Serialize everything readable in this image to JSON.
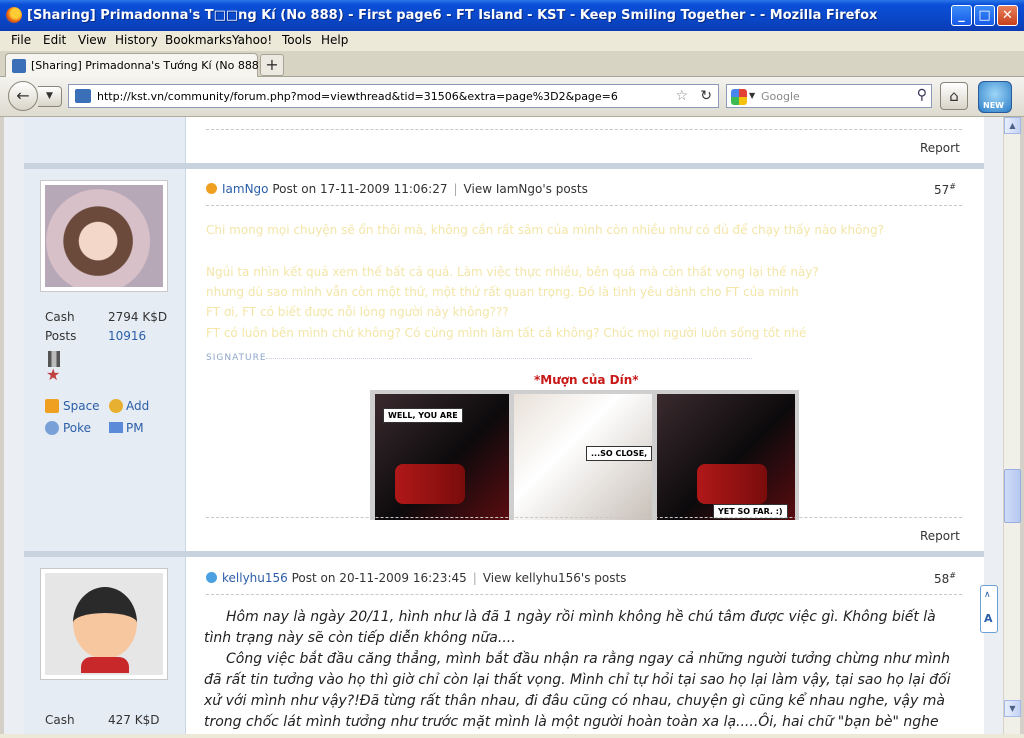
{
  "window": {
    "title": "[Sharing] Primadonna's T□□ng Kí (No 888) - First page6 - FT Island - KST - Keep Smiling Together - - Mozilla Firefox",
    "min": "_",
    "max": "□",
    "close": "✕"
  },
  "menu": [
    "File",
    "Edit",
    "View",
    "History",
    "Bookmarks",
    "Yahoo!",
    "Tools",
    "Help"
  ],
  "tab": {
    "label": "[Sharing] Primadonna's Tướng Kí (No 888) - ...",
    "new_tab": "+"
  },
  "nav": {
    "url": "http://kst.vn/community/forum.php?mod=viewthread&tid=31506&extra=page%3D2&page=6",
    "search_placeholder": "Google",
    "ext_label": "NEW"
  },
  "prev_post": {
    "report": "Report"
  },
  "post57": {
    "user": "IamNgo",
    "posted": "Post on 17-11-2009 11:06:27",
    "view_posts": "View IamNgo's posts",
    "number": "57",
    "cash_label": "Cash",
    "cash_value": "2794 K$D",
    "posts_label": "Posts",
    "posts_value": "10916",
    "links": {
      "space": "Space",
      "add": "Add",
      "poke": "Poke",
      "pm": "PM"
    },
    "faint_lines": [
      "Chi mong mọi chuyện sẽ ổn thôi mà, không cần rất sâm của mình còn nhiều như có đủ để chạy thấy nào không?",
      "Ngủi ta nhìn kết quả xem thế bất cả quá. Làm việc thực nhiều, bên quá mà còn thất vọng lại thế này?",
      "nhưng dù sao mình vẫn còn một thứ, một thứ rất quan trọng. Đó là tình yêu dành cho FT của mình",
      "FT ơi, FT có biết được nỗi lòng người này không???",
      "FT có luôn bên mình chứ không? Có cùng mình làm tất cả không? Chúc mọi người luôn sống tốt nhé"
    ],
    "signature": "SIGNATURE",
    "sig_caption": "*Mượn của Dín*",
    "comic": [
      "WELL, YOU ARE",
      "...SO CLOSE,",
      "YET SO FAR. :)"
    ],
    "report": "Report"
  },
  "post58": {
    "user": "kellyhu156",
    "posted": "Post on 20-11-2009 16:23:45",
    "view_posts": "View kellyhu156's posts",
    "number": "58",
    "cash_label": "Cash",
    "cash_value": "427 K$D",
    "paragraphs": [
      "Hôm nay là ngày 20/11, hình như là đã 1 ngày rồi mình không hề chú tâm được việc gì. Không biết là tình trạng này sẽ còn tiếp diễn không nữa....",
      "Công việc bắt đầu căng thẳng, mình bắt đầu nhận ra rằng ngay cả những người tưởng chừng như mình đã rất tin tưởng vào họ thì giờ chỉ còn lại thất vọng. Mình chỉ tự hỏi tại sao họ lại làm vậy, tại sao họ lại đối xử với mình như vậy?!Đã từng rất thân nhau, đi đâu cũng có nhau, chuyện gì cũng kể nhau nghe, vậy mà trong chốc lát mình tưởng như trước mặt mình là một người hoàn toàn xa lạ.....Ôi, hai chữ \"bạn bè\" nghe sao khó quá......"
    ]
  },
  "float_button": {
    "top": "∧",
    "label": "A"
  },
  "colors": {
    "link": "#2b5ea8",
    "sidebar": "#e5ecf4",
    "title_bar": "#0a47c8",
    "sig_red": "#c81818"
  }
}
